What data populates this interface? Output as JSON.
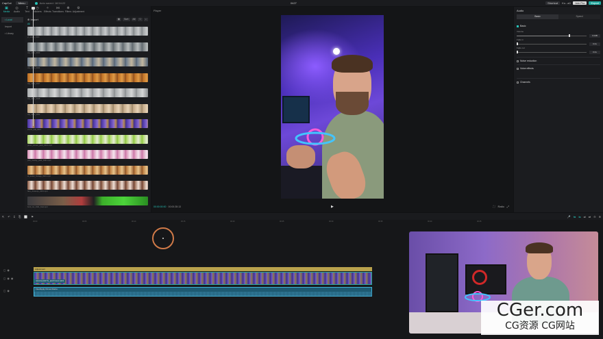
{
  "titlebar": {
    "app": "CapCut",
    "menu": "Menu",
    "autosave": "Auto saved: 18:54:22",
    "title": "0427",
    "shortcut": "Shortcut",
    "user": "Ko...a0",
    "pro": "Join Pro",
    "export": "Export"
  },
  "toolbar": {
    "items": [
      {
        "label": "Media",
        "icon": "▣"
      },
      {
        "label": "Audio",
        "icon": "◎"
      },
      {
        "label": "Text",
        "icon": "T"
      },
      {
        "label": "Stickers",
        "icon": "◷"
      },
      {
        "label": "Effects",
        "icon": "✧"
      },
      {
        "label": "Transitions",
        "icon": "⋈"
      },
      {
        "label": "Filters",
        "icon": "❋"
      },
      {
        "label": "Adjustment",
        "icon": "⚙"
      }
    ]
  },
  "sidebar": {
    "items": [
      "• Local",
      "Import",
      "• Library"
    ]
  },
  "media": {
    "import_label": "⊕ Import",
    "tools": [
      "▦",
      "Sort",
      "All",
      "⛉",
      "⌕"
    ],
    "all_label": "All",
    "clips": [
      {
        "name": "yt_shorts_0421",
        "gradient": "repeating-linear-gradient(90deg,#9a9ea0 0,#c7c9cb 6px,#7e8286 12px)"
      },
      {
        "name": "clip_0421_0043",
        "gradient": "repeating-linear-gradient(90deg,#6f7679 0,#b8bcbd 7px,#5d666c 14px)"
      },
      {
        "name": "clip_0421_0044",
        "gradient": "repeating-linear-gradient(90deg,#6a7b8e 0,#c2b7a0 8px,#516276 16px)"
      },
      {
        "name": "clip_0421_0047",
        "gradient": "repeating-linear-gradient(90deg,#b86a22 0,#e09a45 6px,#8d4d1c 12px)"
      },
      {
        "name": "clip_0421_0048",
        "gradient": "repeating-linear-gradient(90deg,#a6a9ab 0,#d5d6d6 8px,#8a8d90 16px)"
      },
      {
        "name": "clip_0421_0052",
        "gradient": "repeating-linear-gradient(90deg,#c0a584 0,#e8d3b7 7px,#9c8566 14px)"
      },
      {
        "name": "shorts_edit_0421",
        "gradient": "repeating-linear-gradient(90deg,#4632a0 0,#8668d0 6px,#b58a4c 9px,#3a2a86 12px)"
      },
      {
        "name": "green_screen_pack_0421.mp4",
        "gradient": "repeating-linear-gradient(90deg,#a6d65c 0,#e6ecd6 6px,#8ac43a 12px)"
      },
      {
        "name": "pink_overlay_pack_0421.mp4",
        "gradient": "repeating-linear-gradient(90deg,#d88cb4 0,#f5e6ee 6px,#c86ea2 12px)"
      },
      {
        "name": "ai_avatar_footage_0421.mp4",
        "gradient": "repeating-linear-gradient(90deg,#b47236 0,#e8c48c 6px,#8a4e22 12px)"
      },
      {
        "name": "face_closeups_0421.mp4",
        "gradient": "repeating-linear-gradient(90deg,#8c5a42 0,#efe0d6 6px,#6a3a2a 12px)"
      },
      {
        "name": "broll_mix_0421_final.mp4",
        "gradient": "linear-gradient(90deg,#3a3a3e 0,#7a5e48 30%,#b03d3d 45%,#1f1f22 55%,#3cb02a 62%,#4cd43a 80%,#2a8e22 100%)"
      }
    ]
  },
  "player": {
    "label": "Player",
    "current_time": "00:00:00:00",
    "duration": "00:00:28:13",
    "play_icon": "▶",
    "right_controls": [
      "⛶",
      "Ratio",
      "⤢"
    ]
  },
  "inspector": {
    "title": "Audio",
    "tabs": [
      "Basic",
      "Speed"
    ],
    "basic_label": "Basic",
    "volume_label": "Volume",
    "volume_value": "0.0dB",
    "volume_fraction": 0.75,
    "fadein_label": "Fade in",
    "fadein_value": "0.0s",
    "fadeout_label": "Fade out",
    "fadeout_value": "0.0s",
    "noise_label": "Noise reduction",
    "voice_label": "Voice effects",
    "channels_label": "Channels"
  },
  "timeline": {
    "tools_left": [
      "⇱",
      "↶",
      "⌶",
      "⎘",
      "⬜",
      "⚑"
    ],
    "tools_right": [
      "🎤",
      "⇆",
      "⇋",
      "⇌",
      "⇄",
      "⊖",
      "⊕"
    ],
    "ruler": [
      "00:00",
      "00:05",
      "00:10",
      "00:15",
      "00:20",
      "00:25",
      "00:30",
      "00:35",
      "00:40",
      "00:45"
    ],
    "adjustment_label": "Adjustment",
    "video_label": "0421SHORTS_EDIT0421.MP4",
    "audio_label": "Fleahipply Dimemblaine"
  }
}
